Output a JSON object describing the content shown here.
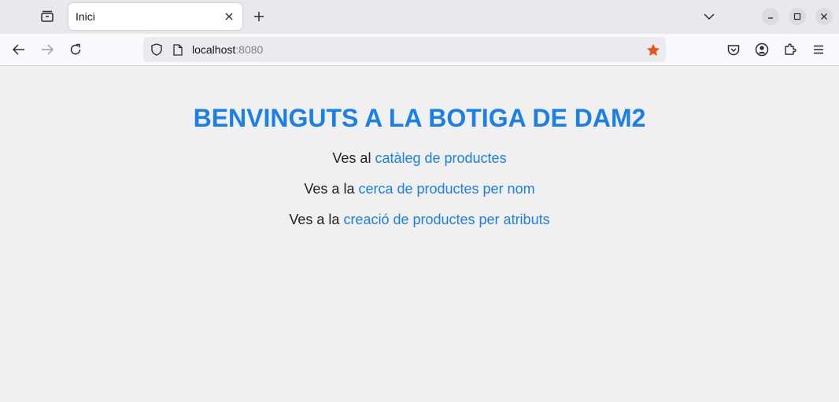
{
  "browser": {
    "tab": {
      "title": "Inici"
    },
    "address": {
      "host": "localhost",
      "port": ":8080"
    },
    "icons": {
      "tab_overview": "tab-overview-icon",
      "close_tab": "close-icon",
      "new_tab": "plus-icon",
      "list_tabs": "chevron-down-icon",
      "back": "back-arrow-icon",
      "forward": "forward-arrow-icon",
      "reload": "reload-icon",
      "tracking": "shield-icon",
      "page": "page-icon",
      "bookmark": "star-icon",
      "pocket": "pocket-icon",
      "account": "account-icon",
      "extensions": "puzzle-icon",
      "menu": "hamburger-menu-icon"
    },
    "colors": {
      "accent": "#1a7fe6",
      "bookmark_star": "#e8541e"
    }
  },
  "page": {
    "heading": "BENVINGUTS A LA BOTIGA DE DAM2",
    "links": [
      {
        "prefix": "Ves al ",
        "link_text": "catàleg de productes"
      },
      {
        "prefix": "Ves a la ",
        "link_text": "cerca de productes per nom"
      },
      {
        "prefix": "Ves a la ",
        "link_text": "creació de productes per atributs"
      }
    ]
  }
}
